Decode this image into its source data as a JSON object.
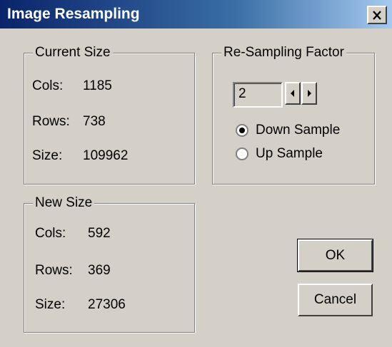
{
  "window": {
    "title": "Image Resampling",
    "close_label": "X"
  },
  "current_size": {
    "legend": "Current Size",
    "rows": [
      {
        "label": "Cols:",
        "value": "1185"
      },
      {
        "label": "Rows:",
        "value": "738"
      },
      {
        "label": "Size:",
        "value": "109962"
      }
    ]
  },
  "new_size": {
    "legend": "New Size",
    "rows": [
      {
        "label": "Cols:",
        "value": "592"
      },
      {
        "label": "Rows:",
        "value": "369"
      },
      {
        "label": "Size:",
        "value": "27306"
      }
    ]
  },
  "resampling": {
    "legend": "Re-Sampling Factor",
    "factor": "2",
    "options": [
      {
        "label": "Down Sample",
        "selected": true
      },
      {
        "label": "Up Sample",
        "selected": false
      }
    ]
  },
  "buttons": {
    "ok": "OK",
    "cancel": "Cancel"
  },
  "colors": {
    "face": "#d4d0c8",
    "title_start": "#0a246a",
    "title_end": "#a6caf0"
  }
}
